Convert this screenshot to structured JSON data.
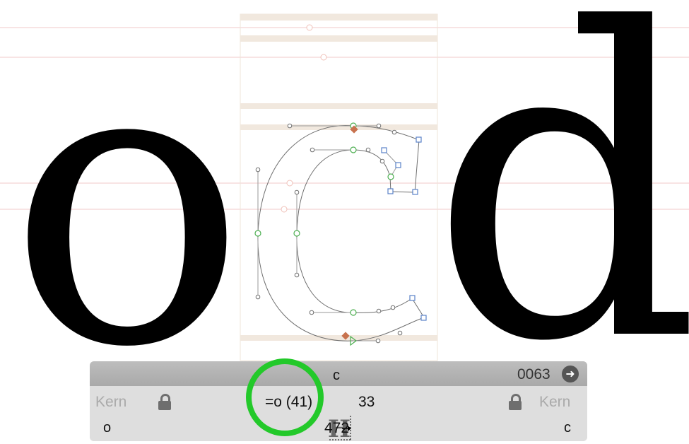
{
  "glyphs": {
    "left": "o",
    "current": "c",
    "right": "d"
  },
  "panel": {
    "glyph_name": "c",
    "unicode": "0063",
    "left_kern_label": "Kern",
    "right_kern_label": "Kern",
    "left_sidebearing": "=o (41)",
    "right_sidebearing": "33",
    "width": "472",
    "left_group": "o",
    "right_group": "c"
  },
  "icons": {
    "next": "arrow-right-circle-icon",
    "lock": "lock-icon",
    "metrics": "metrics-h-icon"
  },
  "colors": {
    "highlight": "#23c92a",
    "metric_line": "#f0c8c8",
    "zone_band": "#f1e8de",
    "node_green": "#4caf50",
    "node_blue": "#5b82c8",
    "anchor": "#c8724e"
  }
}
